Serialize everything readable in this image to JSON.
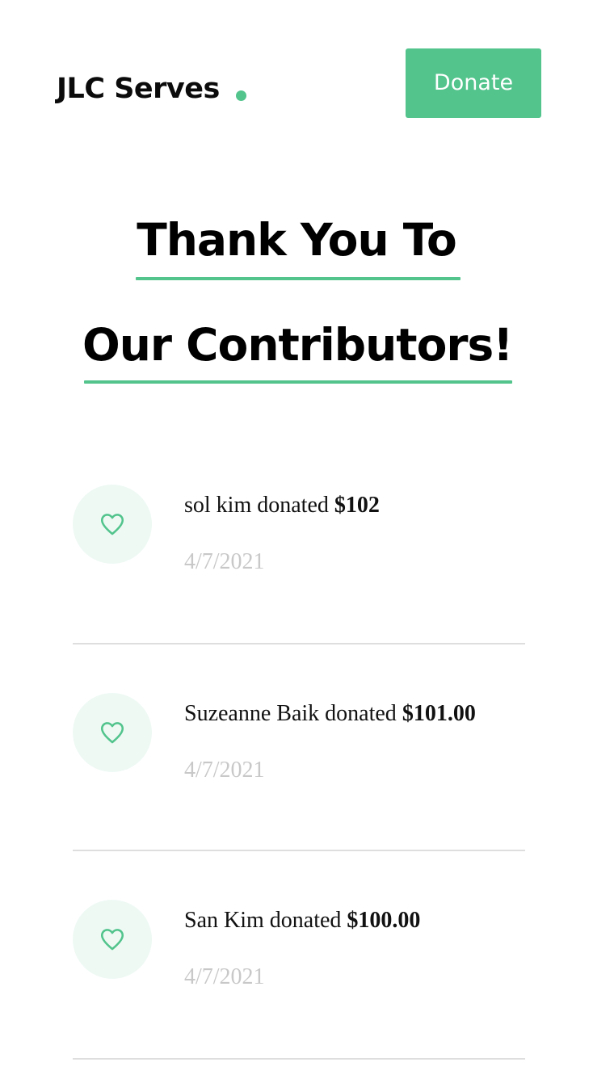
{
  "header": {
    "brand": "JLC Serves",
    "donate_label": "Donate"
  },
  "headline": {
    "line1": "Thank You To",
    "line2": "Our Contributors!"
  },
  "donations": [
    {
      "name": "sol kim",
      "verb": "donated",
      "amount": "$102",
      "date": "4/7/2021"
    },
    {
      "name": "Suzeanne Baik",
      "verb": "donated",
      "amount": "$101.00",
      "date": "4/7/2021"
    },
    {
      "name": "San Kim",
      "verb": "donated",
      "amount": "$100.00",
      "date": "4/7/2021"
    }
  ],
  "icons": {
    "donation_icon": "heart-icon"
  },
  "colors": {
    "accent": "#52c48c",
    "accent_soft": "#eef9f4",
    "divider": "#dedede",
    "date_text": "#c8c8c8"
  }
}
